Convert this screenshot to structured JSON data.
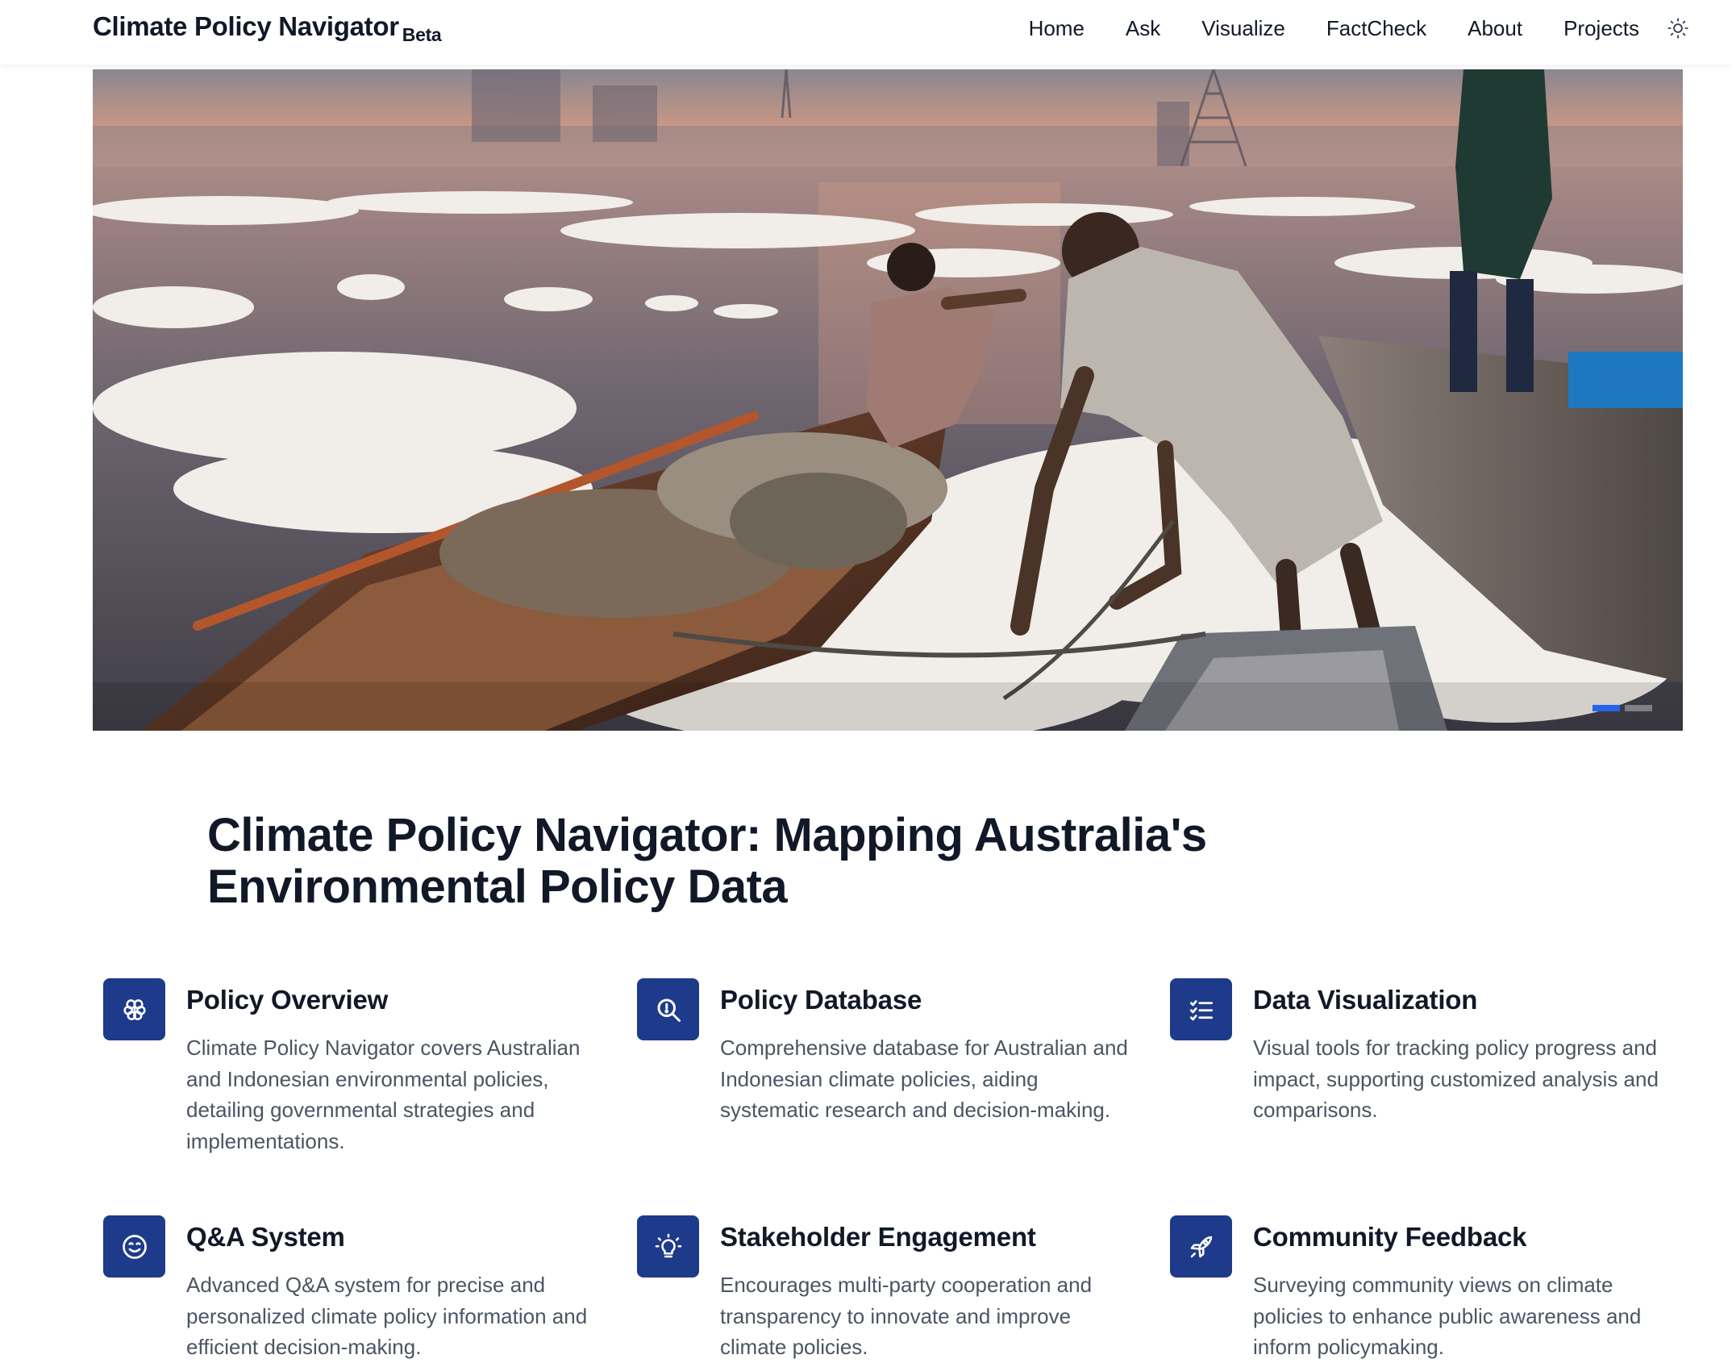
{
  "header": {
    "brand": "Climate Policy Navigator",
    "brand_badge": "Beta",
    "nav": [
      "Home",
      "Ask",
      "Visualize",
      "FactCheck",
      "About",
      "Projects"
    ],
    "theme_toggle_icon": "sun-icon"
  },
  "hero": {
    "image_alt": "Fishermen on wooden boats in a river covered with toxic white foam at dusk",
    "carousel_dots": 2,
    "active_dot": 0,
    "active_color": "#2563eb"
  },
  "main": {
    "headline": "Climate Policy Navigator: Mapping Australia's Environmental Policy Data"
  },
  "features": [
    {
      "icon": "brain-icon",
      "title": "Policy Overview",
      "description": "Climate Policy Navigator covers Australian and Indonesian environmental policies, detailing governmental strategies and implementations."
    },
    {
      "icon": "search-icon",
      "title": "Policy Database",
      "description": "Comprehensive database for Australian and Indonesian climate policies, aiding systematic research and decision-making."
    },
    {
      "icon": "checklist-icon",
      "title": "Data Visualization",
      "description": "Visual tools for tracking policy progress and impact, supporting customized analysis and comparisons."
    },
    {
      "icon": "smile-icon",
      "title": "Q&A System",
      "description": "Advanced Q&A system for precise and personalized climate policy information and efficient decision-making."
    },
    {
      "icon": "lightbulb-icon",
      "title": "Stakeholder Engagement",
      "description": "Encourages multi-party cooperation and transparency to innovate and improve climate policies."
    },
    {
      "icon": "rocket-icon",
      "title": "Community Feedback",
      "description": "Surveying community views on climate policies to enhance public awareness and inform policymaking."
    }
  ],
  "colors": {
    "icon_bg": "#1e3a8a",
    "text_primary": "#111827",
    "text_secondary": "#4b5563"
  }
}
